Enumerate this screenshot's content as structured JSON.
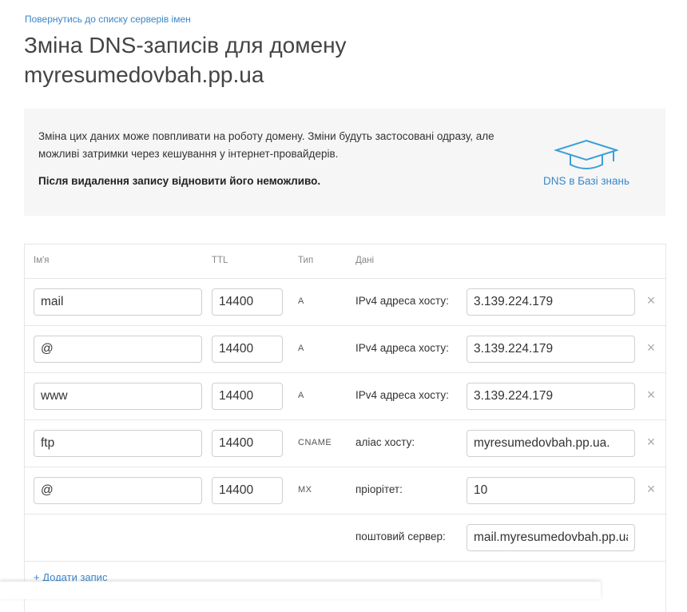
{
  "nav": {
    "back_link": "Повернутись до списку серверів імен"
  },
  "page": {
    "title": "Зміна DNS-записів для домену myresumedovbah.pp.ua"
  },
  "info": {
    "text": "Зміна цих даних може повпливати на роботу домену. Зміни будуть застосовані одразу, але можливі затримки через кешування у інтернет-провайдерів.",
    "warning": "Після видалення запису відновити його неможливо.",
    "kb_link": "DNS в Базі знань",
    "kb_icon": "graduation-cap-icon"
  },
  "table": {
    "headers": {
      "name": "Ім'я",
      "ttl": "TTL",
      "type": "Тип",
      "data": "Дані"
    },
    "rows": [
      {
        "name": "mail",
        "ttl": "14400",
        "type": "A",
        "label": "IPv4 адреса хосту:",
        "value": "3.139.224.179"
      },
      {
        "name": "@",
        "ttl": "14400",
        "type": "A",
        "label": "IPv4 адреса хосту:",
        "value": "3.139.224.179"
      },
      {
        "name": "www",
        "ttl": "14400",
        "type": "A",
        "label": "IPv4 адреса хосту:",
        "value": "3.139.224.179"
      },
      {
        "name": "ftp",
        "ttl": "14400",
        "type": "CNAME",
        "label": "аліас хосту:",
        "value": "myresumedovbah.pp.ua."
      },
      {
        "name": "@",
        "ttl": "14400",
        "type": "MX",
        "label": "пріорітет:",
        "value": "10"
      }
    ],
    "mx_extra": {
      "label": "поштовий сервер:",
      "value": "mail.myresumedovbah.pp.ua."
    },
    "delete_icon": "×",
    "add_record": "+ Додати запис"
  },
  "colors": {
    "accent": "#3a86c8",
    "info_bg": "#f6f6f6",
    "border": "#e6e6e6"
  }
}
